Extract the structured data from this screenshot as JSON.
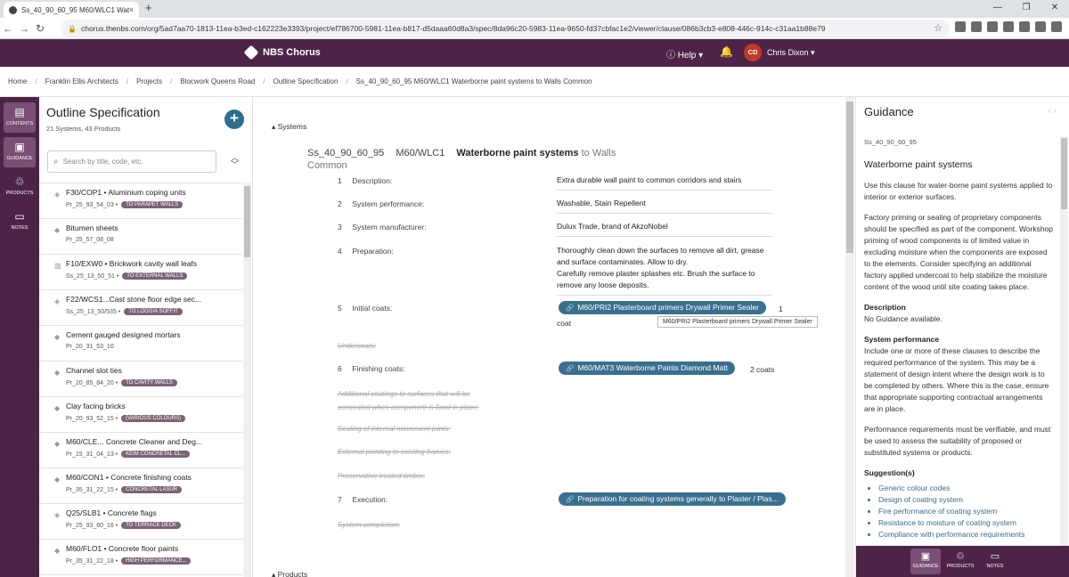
{
  "browser": {
    "tab_title": "Ss_40_90_60_95 M60/WLC1 Wate",
    "tab_close": "×",
    "new_tab": "+",
    "url": "chorus.thenbs.com/org/5ad7aa70-1813-11ea-b3ed-c162223e3393/project/ef786700-5981-11ea-b817-d5daaa60d8a3/spec/8da96c20-5983-11ea-9650-fd37cbfac1e2/viewer/clause/086b3cb3-e808-446c-914c-c31aa1b88e79"
  },
  "header": {
    "app_name": "NBS Chorus",
    "help_label": "Help ▾",
    "avatar_initials": "CD",
    "user_name": "Chris Dixon ▾"
  },
  "breadcrumbs": [
    "Home",
    "Franklin Ellis Architects",
    "Projects",
    "Blocwork Queens Road",
    "Outline Specification",
    "Ss_40_90_60_95 M60/WLC1 Waterborne paint systems to Walls Common"
  ],
  "breadcrumb_sep": "/",
  "rail": [
    {
      "label": "CONTENTS",
      "icon": "▤"
    },
    {
      "label": "GUIDANCE",
      "icon": "▣"
    },
    {
      "label": "PRODUCTS",
      "icon": "♲"
    },
    {
      "label": "NOTES",
      "icon": "▭"
    }
  ],
  "left_panel": {
    "title": "Outline Specification",
    "subtitle": "21 Systems, 43 Products",
    "add": "+",
    "search_placeholder": "Search by title, code, etc.",
    "items": [
      {
        "title": "F30/COP1 • Aluminium coping units",
        "code": "Pr_25_93_54_03 •",
        "tag": "TO PARAPET WALLS"
      },
      {
        "title": "Bitumen sheets",
        "code": "Pr_25_57_08_08",
        "tag": ""
      },
      {
        "title": "F10/EXW0 • Brickwork cavity wall leafs",
        "code": "Ss_25_13_50_51 •",
        "tag": "TO EXTERNAL WALLS"
      },
      {
        "title": "F22/WCS1...Cast stone floor edge sec...",
        "code": "Ss_25_13_50/535 •",
        "tag": "TO LOGGIA SOFFIT"
      },
      {
        "title": "Cement gauged designed mortars",
        "code": "Pr_20_31_53_10",
        "tag": ""
      },
      {
        "title": "Channel slot ties",
        "code": "Pr_20_85_84_20 •",
        "tag": "TO CAVITY WALLS"
      },
      {
        "title": "Clay facing bricks",
        "code": "Pr_20_93_52_15 •",
        "tag": "(VARIOUS COLOURS)"
      },
      {
        "title": "M60/CLE... Concrete Cleaner and Deg...",
        "code": "Pr_15_31_04_13 •",
        "tag": "KEIM CONCRETAL CL..."
      },
      {
        "title": "M60/CON1 • Concrete finishing coats",
        "code": "Pr_35_31_22_15 •",
        "tag": "CONCRETAL LASUR"
      },
      {
        "title": "Q25/SLB1 • Concrete flags",
        "code": "Pr_25_93_60_16 •",
        "tag": "TO TERRACE DECK"
      },
      {
        "title": "M60/FLO1 • Concrete floor paints",
        "code": "Pr_35_31_22_18 •",
        "tag": "HIGH PERFORMANCE..."
      }
    ]
  },
  "main": {
    "section_label": "▴  Systems",
    "clause_code": "Ss_40_90_60_95",
    "clause_ref": "M60/WLC1",
    "clause_name": "Waterborne paint systems",
    "clause_suffix": "to Walls Common",
    "rows": [
      {
        "num": "1",
        "label": "Description:",
        "value": "Extra durable wall paint to common corridors and stairs"
      },
      {
        "num": "2",
        "label": "System performance:",
        "value": "Washable, Stain Repellent"
      },
      {
        "num": "3",
        "label": "System manufacturer:",
        "value": "Dulux Trade, brand of AkzoNobel"
      },
      {
        "num": "4",
        "label": "Preparation:",
        "value": "Thoroughly clean down the surfaces to remove all dirt, grease and surface contaminates. Allow to dry.\nCarefully remove plaster splashes etc. Brush the surface to remove any loose deposits."
      },
      {
        "num": "5",
        "label": "Initial coats:",
        "value": ""
      },
      {
        "num": "6",
        "label": "Finishing coats:",
        "value": ""
      },
      {
        "num": "7",
        "label": "Execution:",
        "value": ""
      }
    ],
    "initial_pill": "M60/PRI2 Plasterboard primers Drywall Primer Sealer",
    "initial_after": "1",
    "initial_coat_word": "coat",
    "tooltip": "M60/PRI2 Plasterboard primers Drywall Primer Sealer",
    "finishing_pill": "M60/MAT3 Waterborne Paints Diamond Matt",
    "finishing_after": "2 coats",
    "execution_pill": "Preparation for coating systems generally to Plaster / Plas...",
    "struck": {
      "undercoats": "Undercoats:",
      "additional": "Additional coatings to surfaces that will be",
      "concealed": "concealed when component is fixed in place:",
      "sealing": "Sealing of internal movement joints:",
      "external": "External pointing to existing frames:",
      "preservative": "Preservative treated timber:",
      "completion": "System completion:"
    },
    "products_label": "▴  Products"
  },
  "guidance": {
    "title": "Guidance",
    "nav": "‹  ›",
    "code": "Ss_40_90_60_95",
    "heading": "Waterborne paint systems",
    "p1": "Use this clause for water-borne paint systems applied to interior or exterior surfaces.",
    "p2": "Factory priming or sealing of proprietary components should be specified as part of the component. Workshop priming of wood components is of limited value in excluding moisture when the components are exposed to the elements. Consider specifying an additional factory applied undercoat to help stabilize the moisture content of the wood until site coating takes place.",
    "desc_h": "Description",
    "desc": "No Guidance available.",
    "perf_h": "System performance",
    "perf1": "Include one or more of these clauses to describe the required performance of the system. This may be a statement of design intent where the design work is to be completed by others. Where this is the case, ensure that appropriate supporting contractual arrangements are in place.",
    "perf2": "Performance requirements must be verifiable, and must be used to assess the suitability of proposed or substituted systems or products.",
    "sugg_h": "Suggestion(s)",
    "suggestions": [
      "Generic colour codes",
      "Design of coating system",
      "Fire performance of coating system",
      "Resistance to moisture of coating system",
      "Compliance with performance requirements"
    ]
  },
  "guidance_footer": [
    {
      "label": "GUIDANCE",
      "icon": "▣"
    },
    {
      "label": "PRODUCTS",
      "icon": "♲"
    },
    {
      "label": "NOTES",
      "icon": "▭"
    }
  ]
}
